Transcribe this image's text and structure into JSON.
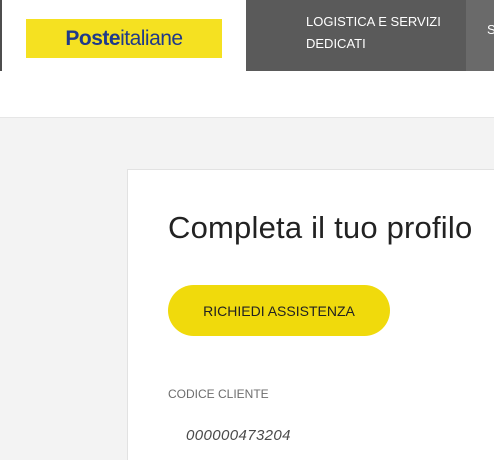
{
  "header": {
    "logo": {
      "text_bold": "Poste",
      "text_regular": "italiane"
    },
    "nav": [
      {
        "label": "LOGISTICA E SERVIZI DEDICATI"
      },
      {
        "label": "S"
      }
    ]
  },
  "main": {
    "title": "Completa il tuo profilo",
    "assistance_button": "RICHIEDI ASSISTENZA",
    "fields": [
      {
        "label": "CODICE CLIENTE",
        "value": "000000473204"
      }
    ]
  },
  "colors": {
    "brand_yellow": "#f5e121",
    "button_yellow": "#f0da0c",
    "brand_blue": "#1f3a8a",
    "nav_gray": "#5a5a5a"
  }
}
